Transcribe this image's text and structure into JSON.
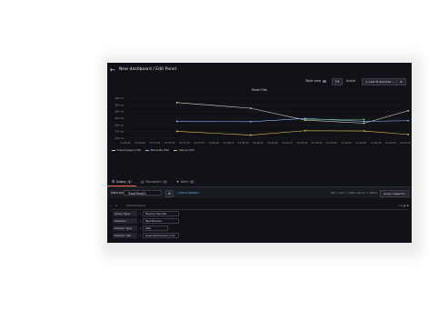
{
  "header": {
    "title": "New dashboard / Edit Panel"
  },
  "toolbar": {
    "table_view_label": "Table view",
    "fill_label": "Fill",
    "actual_label": "Actual",
    "time_range": "Last 6 minutes"
  },
  "panel": {
    "title": "Panel Title"
  },
  "chart_data": {
    "type": "line",
    "title": "Panel Title",
    "y_tick_labels": [
      "390 ms",
      "350 ms",
      "300 ms",
      "250 ms",
      "200 ms",
      "150 ms",
      "100 ms"
    ],
    "x_tick_labels": [
      "12:36:30",
      "12:36:45",
      "12:37:00",
      "12:37:15",
      "12:37:30",
      "12:37:45",
      "12:38:00",
      "12:38:15",
      "12:38:30",
      "12:38:45",
      "12:39:00",
      "12:39:15",
      "12:39:30",
      "12:39:45",
      "12:40:00",
      "12:40:15",
      "12:40:30",
      "12:40:45",
      "12:41:00",
      "12:41:15"
    ],
    "x_indices": [
      3.5,
      8.5,
      12.2,
      16.2,
      19.2
    ],
    "ylim": [
      90,
      410
    ],
    "series": [
      {
        "name": "Copenhagen (CD)",
        "color": "#d6d0c0",
        "values": [
          375,
          330,
          235,
          210,
          310
        ]
      },
      {
        "name": "Marseille (FR)",
        "color": "#8ab8ff",
        "values": [
          225,
          222,
          248,
          225,
          230
        ]
      },
      {
        "name": "Vienna (AT)",
        "color": "#e8c24a",
        "values": [
          145,
          115,
          150,
          148,
          120
        ]
      }
    ],
    "extra_series_color": "#73bf69",
    "extra_series_values": [
      null,
      null,
      240,
      240,
      null
    ]
  },
  "tabs": [
    {
      "label": "Query",
      "badge": "1"
    },
    {
      "label": "Transform",
      "badge": "0"
    },
    {
      "label": "Alert",
      "badge": "0"
    }
  ],
  "query_row": {
    "data_source_label": "Data source",
    "data_source": "TrackTimeIO",
    "query_options": "Query options",
    "meta": "MD = auto = 1468   Interval = 300ms",
    "query_inspector": "Query inspector"
  },
  "query": {
    "ref_id": "A",
    "source": "(TrackTimeIO)",
    "fields": [
      {
        "label": "Query Type",
        "value": "Monitor Results"
      },
      {
        "label": "Monitors",
        "value": "Test Monitor"
      },
      {
        "label": "Monitor Type",
        "value": "http"
      },
      {
        "label": "Monitor URL",
        "value": "www.testmonitor.com"
      }
    ]
  }
}
